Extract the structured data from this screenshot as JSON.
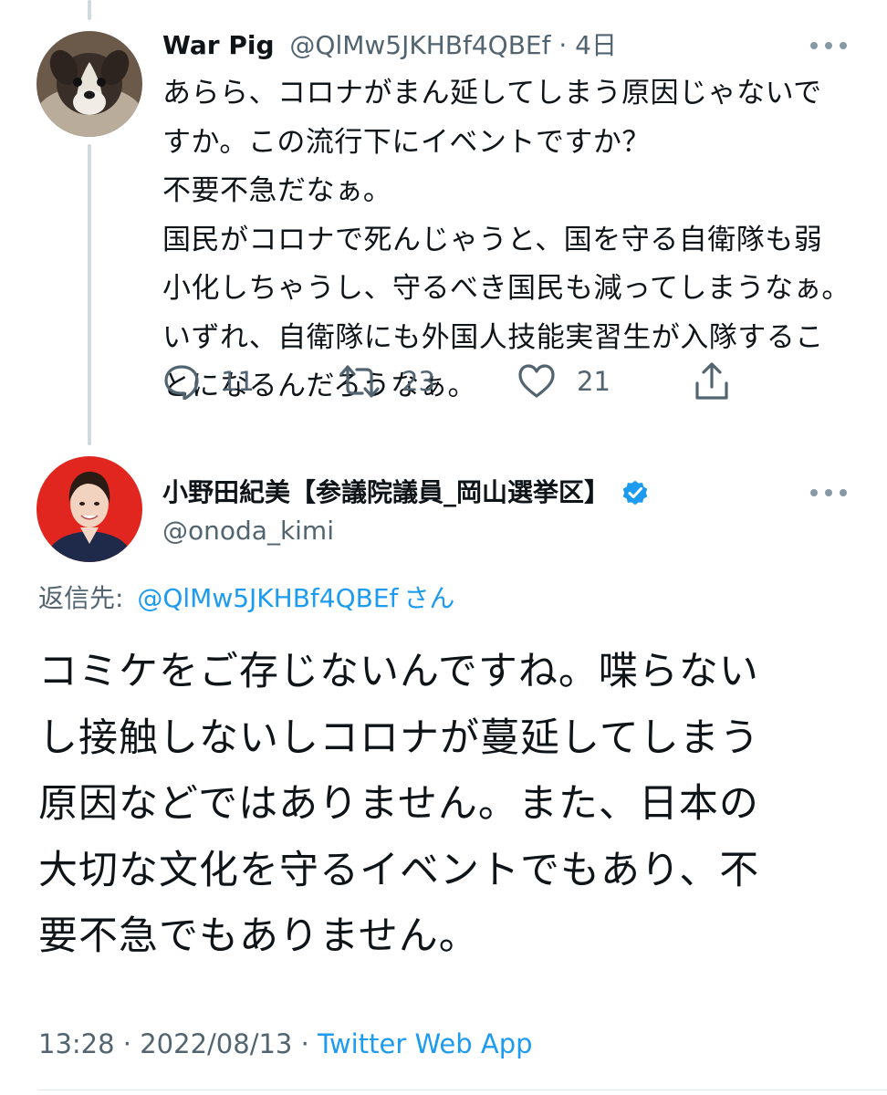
{
  "colors": {
    "text_primary": "#0f1419",
    "text_secondary": "#536471",
    "link_blue": "#1d9bf0",
    "verified_blue": "#1d9bf0",
    "avatar2_bg": "#e0261f"
  },
  "tweet1": {
    "display_name": "War Pig",
    "handle": "@QlMw5JKHBf4QBEf",
    "separator": "·",
    "time": "4日",
    "more_icon": "more-horizontal-icon",
    "lines": [
      "あらら、コロナがまん延してしまう原因じゃないで",
      "すか。この流行下にイベントですか？",
      "不要不急だなぁ。",
      "国民がコロナで死んじゃうと、国を守る自衛隊も弱",
      "小化しちゃうし、守るべき国民も減ってしまうなぁ。",
      "いずれ、自衛隊にも外国人技能実習生が入隊するこ",
      "とになるんだろうなぁ。"
    ],
    "actions": {
      "reply": {
        "icon": "reply-icon",
        "count": "11"
      },
      "retweet": {
        "icon": "retweet-icon",
        "count": "23"
      },
      "like": {
        "icon": "heart-icon",
        "count": "21"
      },
      "share": {
        "icon": "share-icon"
      }
    }
  },
  "tweet2": {
    "display_name": "小野田紀美【参議院議員_岡山選挙区】",
    "verified_icon": "verified-badge-icon",
    "handle": "@onoda_kimi",
    "more_icon": "more-horizontal-icon",
    "reply_prefix": "返信先:",
    "reply_mention": "@QlMw5JKHBf4QBEf",
    "reply_suffix": "さん",
    "lines": [
      "コミケをご存じないんですね。喋らない",
      "し接触しないしコロナが蔓延してしまう",
      "原因などではありません。また、日本の",
      "大切な文化を守るイベントでもあり、不",
      "要不急でもありません。"
    ],
    "time": "13:28",
    "date": "2022/08/13",
    "dot": "·",
    "source": "Twitter Web App"
  }
}
